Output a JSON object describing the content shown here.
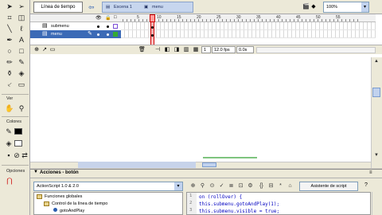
{
  "timeline": {
    "tab_label": "Línea de tiempo",
    "breadcrumb": [
      "Escena 1",
      "menu"
    ],
    "zoom": "100%",
    "layers": [
      {
        "name": "submenu",
        "color": "#7b4fd6"
      },
      {
        "name": "menu",
        "color": "#33aa33"
      }
    ],
    "ruler_labels": [
      "5",
      "10",
      "15",
      "20",
      "25",
      "30",
      "35",
      "40",
      "45",
      "50",
      "55"
    ],
    "footer": {
      "current_frame": "1",
      "fps": "12.0 fps",
      "time": "0.0s"
    }
  },
  "tools": {
    "view_label": "Ver",
    "colors_label": "Colores",
    "options_label": "Opciones"
  },
  "actions": {
    "title": "Acciones - botón",
    "script_version": "ActionScript 1.0 & 2.0",
    "tree": [
      {
        "label": "Funciones globales"
      },
      {
        "label": "Control de la línea de tiempo"
      },
      {
        "label": "gotoAndPlay"
      }
    ],
    "script_assist": "Asistente de script",
    "code_lines": [
      "on (rollOver) {",
      "this.submenu.gotoAndPlay(1);",
      "this.submenu.visible = true;"
    ],
    "line_numbers": [
      "1",
      "2",
      "3"
    ]
  }
}
